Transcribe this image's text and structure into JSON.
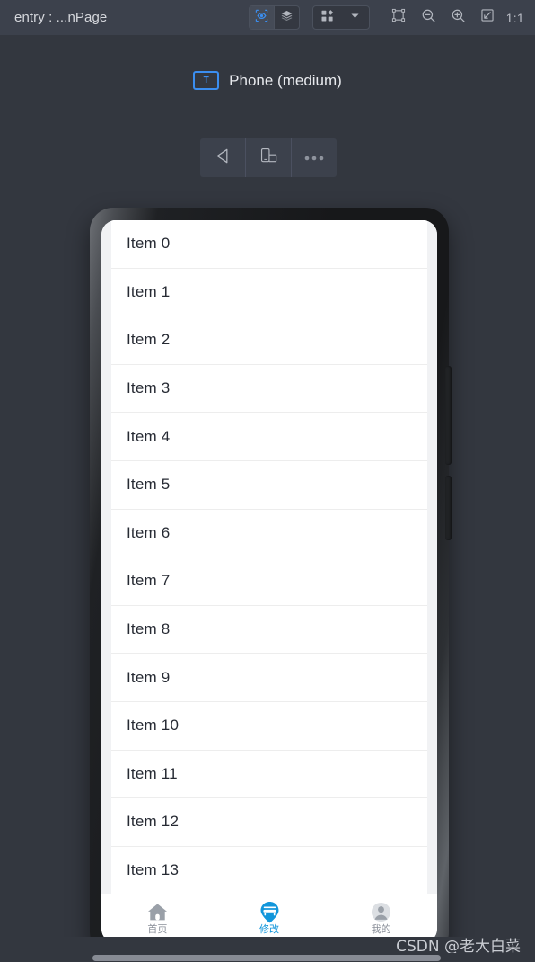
{
  "titlebar": {
    "title": "entry : ...nPage",
    "toggle_group": [
      {
        "name": "preview-eye-icon",
        "label": "",
        "active": true
      },
      {
        "name": "layers-icon",
        "label": "",
        "active": false
      }
    ],
    "component_group": [
      {
        "name": "components-grid-icon",
        "label": ""
      },
      {
        "name": "chevron-down-icon",
        "label": ""
      }
    ],
    "tools": [
      {
        "name": "select-frame-icon",
        "label": ""
      },
      {
        "name": "zoom-out-icon",
        "label": ""
      },
      {
        "name": "zoom-in-icon",
        "label": ""
      },
      {
        "name": "fit-screen-icon",
        "label": ""
      }
    ],
    "zoom_ratio": "1:1"
  },
  "preview": {
    "device_icon_glyph": "T",
    "device_name": "Phone (medium)",
    "device_toolbar": [
      {
        "name": "back-button",
        "label": ""
      },
      {
        "name": "rotate-device-button",
        "label": ""
      },
      {
        "name": "more-options-button",
        "label": ""
      }
    ]
  },
  "phone": {
    "list_items": [
      {
        "label": "Item 0"
      },
      {
        "label": "Item 1"
      },
      {
        "label": "Item 2"
      },
      {
        "label": "Item 3"
      },
      {
        "label": "Item 4"
      },
      {
        "label": "Item 5"
      },
      {
        "label": "Item 6"
      },
      {
        "label": "Item 7"
      },
      {
        "label": "Item 8"
      },
      {
        "label": "Item 9"
      },
      {
        "label": "Item 10"
      },
      {
        "label": "Item 11"
      },
      {
        "label": "Item 12"
      },
      {
        "label": "Item 13"
      }
    ],
    "bottom_nav": [
      {
        "name": "home",
        "label": "首页",
        "icon": "home-icon",
        "active": false
      },
      {
        "name": "modify",
        "label": "修改",
        "icon": "bus-pin-icon",
        "active": true
      },
      {
        "name": "mine",
        "label": "我的",
        "icon": "person-icon",
        "active": false
      }
    ]
  },
  "footer": {
    "watermark": "CSDN @老大白菜"
  },
  "colors": {
    "titlebar_bg": "#3c414c",
    "canvas_bg": "#33373f",
    "accent_blue": "#3b8ef0",
    "nav_active": "#1296db",
    "screen_bg": "#f1f2f4",
    "list_bg": "#ffffff",
    "list_text": "#262a33"
  }
}
